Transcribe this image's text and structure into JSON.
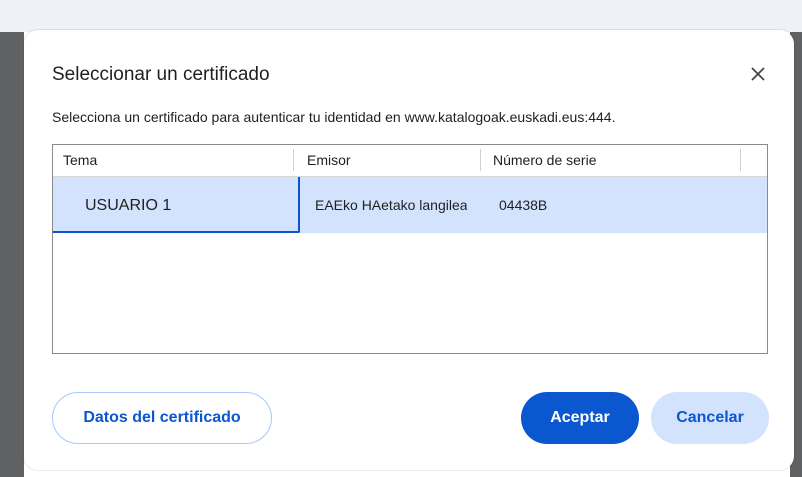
{
  "dialog": {
    "title": "Seleccionar un certificado",
    "description": "Selecciona un certificado para autenticar tu identidad en www.katalogoak.euskadi.eus:444."
  },
  "table": {
    "columns": [
      "Tema",
      "Emisor",
      "Número de serie"
    ],
    "rows": [
      {
        "tema": "USUARIO 1",
        "emisor": "EAEko HAetako langileak",
        "serie": "04438B"
      }
    ]
  },
  "buttons": {
    "details_label": "Datos del certificado",
    "accept_label": "Aceptar",
    "cancel_label": "Cancelar"
  },
  "icons": {
    "close": "close-icon"
  },
  "colors": {
    "accent": "#0b57d0",
    "selected_row": "#d3e3fd",
    "outline_button_border": "#a8c7fa"
  }
}
